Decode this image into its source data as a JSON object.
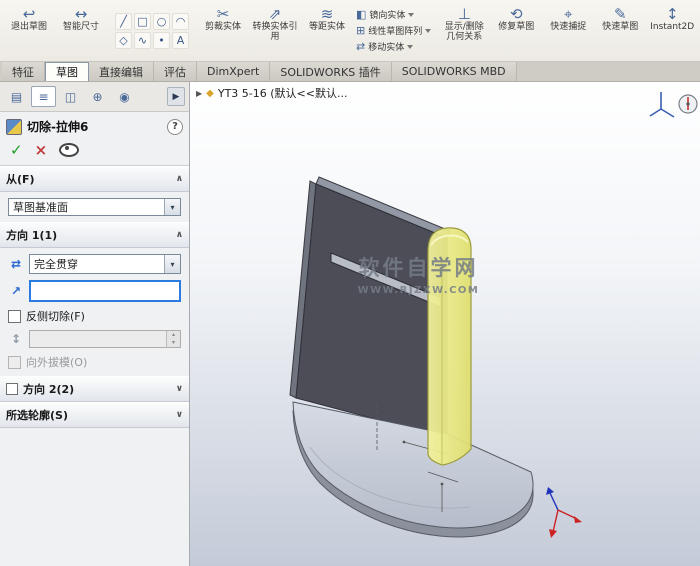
{
  "ribbon": {
    "left_buttons": [
      {
        "label": "退出草图",
        "glyph": "↩"
      },
      {
        "label": "智能尺寸",
        "glyph": "↔"
      }
    ],
    "sketch_tool_glyphs": [
      "╱",
      "□",
      "○",
      "◠",
      "◇",
      "∿",
      "•",
      "A"
    ],
    "mid_buttons": [
      {
        "label": "剪裁实体",
        "glyph": "✂"
      },
      {
        "label": "转换实体引用",
        "glyph": "⇗"
      },
      {
        "label": "等距实体",
        "glyph": "≋"
      }
    ],
    "stack_buttons": [
      {
        "label": "镜向实体",
        "glyph": "◧"
      },
      {
        "label": "线性草图阵列",
        "glyph": "⊞"
      },
      {
        "label": "移动实体",
        "glyph": "⇄"
      }
    ],
    "right_buttons": [
      {
        "label": "显示/删除几何关系",
        "glyph": "⊥"
      },
      {
        "label": "修复草图",
        "glyph": "⟲"
      },
      {
        "label": "快速捕捉",
        "glyph": "⌖"
      },
      {
        "label": "快速草图",
        "glyph": "✎"
      },
      {
        "label": "Instant2D",
        "glyph": "↕"
      }
    ]
  },
  "tabs": [
    {
      "label": "特征",
      "active": false
    },
    {
      "label": "草图",
      "active": true
    },
    {
      "label": "直接编辑",
      "active": false
    },
    {
      "label": "评估",
      "active": false
    },
    {
      "label": "DimXpert",
      "active": false
    },
    {
      "label": "SOLIDWORKS 插件",
      "active": false
    },
    {
      "label": "SOLIDWORKS MBD",
      "active": false
    }
  ],
  "panel_tabs": [
    {
      "name": "featuremanager",
      "glyph": "▤",
      "active": false
    },
    {
      "name": "propertymanager",
      "glyph": "≡",
      "active": true
    },
    {
      "name": "configurationmanager",
      "glyph": "◫",
      "active": false
    },
    {
      "name": "dimxpertmanager",
      "glyph": "⊕",
      "active": false
    },
    {
      "name": "displaymanager",
      "glyph": "◉",
      "active": false
    }
  ],
  "property_manager": {
    "title": "切除-拉伸6",
    "sections": {
      "from": {
        "label": "从(F)",
        "plane_value": "草图基准面"
      },
      "direction1": {
        "label": "方向 1(1)",
        "end_condition_value": "完全贯穿",
        "selection_value": "",
        "flip_side_label": "反侧切除(F)",
        "depth_value": "",
        "draft_outward_label": "向外拔模(O)"
      },
      "direction2": {
        "label": "方向 2(2)"
      },
      "selected_contours": {
        "label": "所选轮廓(S)"
      }
    }
  },
  "feature_tree": {
    "root_label": "YT3 5-16 (默认<<默认..."
  },
  "viewport": {
    "watermark_title": "软件自学网",
    "watermark_url": "WWW.RJZXW.COM"
  },
  "icons": {
    "chevron_up": "∧",
    "chevron_down": "∨",
    "dropdown_arrow": "▾",
    "ok": "✓",
    "cancel": "×",
    "spin_up": "▴",
    "spin_down": "▾",
    "breadcrumb_arrow": "▶",
    "part": "◆",
    "panel_expand": "▶",
    "direction_flip": "⇄",
    "selection_arrow": "↗",
    "depth": "↕",
    "help": "?"
  },
  "colors": {
    "highlight_yellow": "#eaea86",
    "plate_gray": "#4d4d57",
    "base_gray": "#ccd1da",
    "accent_blue": "#2a7ae0"
  }
}
